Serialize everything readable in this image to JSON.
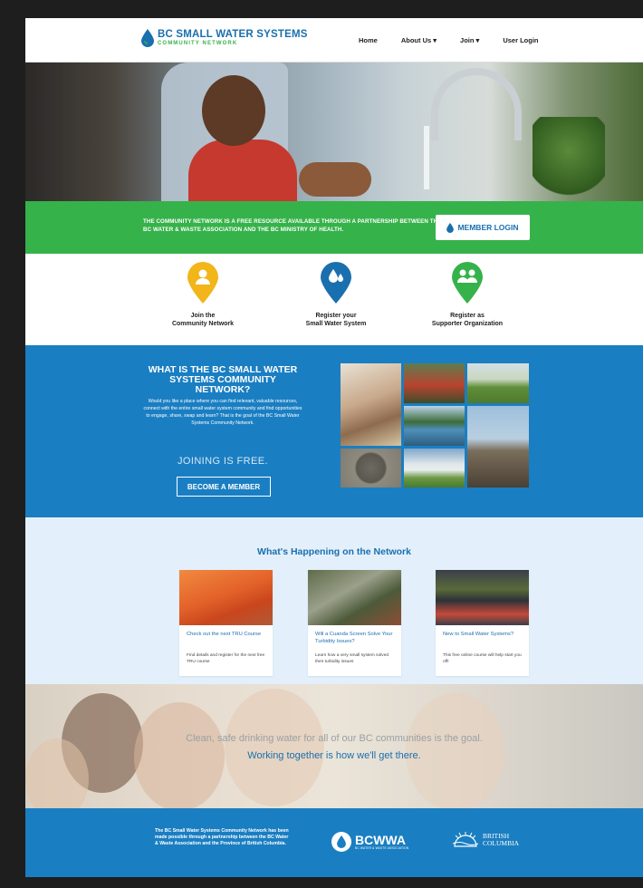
{
  "nav": {
    "logo_title": "BC SMALL WATER SYSTEMS",
    "logo_subtitle": "COMMUNITY NETWORK",
    "links": [
      "Home",
      "About Us ▾",
      "Join ▾",
      "User Login"
    ]
  },
  "banner": {
    "text": "THE COMMUNITY NETWORK IS A FREE RESOURCE AVAILABLE THROUGH A PARTNERSHIP BETWEEN THE BC WATER & WASTE ASSOCIATION AND THE BC MINISTRY OF HEALTH.",
    "login_label": "MEMBER LOGIN"
  },
  "actions": [
    {
      "line1": "Join the",
      "line2": "Community Network",
      "color": "#f2b51a",
      "icon": "person-icon"
    },
    {
      "line1": "Register your",
      "line2": "Small Water System",
      "color": "#1a6fae",
      "icon": "water-drops-icon"
    },
    {
      "line1": "Register as",
      "line2": "Supporter Organization",
      "color": "#36b24a",
      "icon": "group-icon"
    }
  ],
  "about": {
    "title_line1": "WHAT IS THE BC SMALL WATER",
    "title_line2": "SYSTEMS COMMUNITY NETWORK?",
    "body": "Would you like a place where you can find relevant, valuable resources, connect with the entire small water system community and find opportunities to engage, share, swap and learn? That is the goal of the BC Small Water Systems Community Network.",
    "free_text": "JOINING IS FREE.",
    "button_label": "BECOME A MEMBER"
  },
  "news": {
    "title": "What's Happening on the Network",
    "cards": [
      {
        "title": "Check out the next TRU Course",
        "text": "Find details and register for the next free TRU course",
        "img_color": "#e4622a"
      },
      {
        "title": "Will a Cuanda Screen Solve Your Turbidity Issues?",
        "text": "Learn how a very small system solved their turbidity issues",
        "img_color": "#6f7a5e"
      },
      {
        "title": "New to Small Water Systems?",
        "text": "This free online course will help start you off!",
        "img_color": "#3a3f49"
      }
    ]
  },
  "quote": {
    "line1": "Clean, safe drinking water for all of our BC communities is the goal.",
    "line2": "Working together is how we'll get there."
  },
  "footer": {
    "text": "The BC Small Water Systems Community Network has been made possible through a partnership between the BC Water & Waste Association and the Province of British Columbia.",
    "bcwwa_name": "BCWWA",
    "bcwwa_sub": "BC WATER & WASTE ASSOCIATION",
    "bc_line1": "BRITISH",
    "bc_line2": "COLUMBIA"
  },
  "colors": {
    "brand_blue": "#1a7ec2",
    "brand_green": "#36b24a",
    "light_blue": "#e3f0fb"
  }
}
